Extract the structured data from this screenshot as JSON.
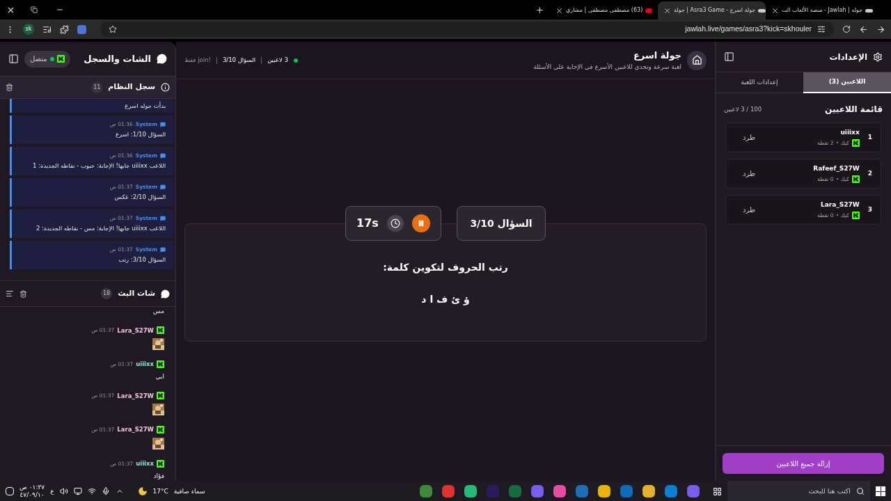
{
  "browser": {
    "tabs": [
      {
        "title": "جولة | Jawlah - منصة الألعاب الت",
        "selected": false
      },
      {
        "title": "جولة اسرع - Asra3 Game | جولة",
        "selected": true
      },
      {
        "title": "(63) مصطفى مصطفى | مشاري",
        "selected": false
      }
    ],
    "url": "jawlah.live/games/asra3?kick=skhouler",
    "profile": "sk"
  },
  "chat_panel": {
    "title": "الشات والسجل",
    "status": "متصل",
    "connected": true,
    "log": {
      "title": "سجل النظام",
      "count": "11",
      "entries": [
        {
          "text": "بدأت جوله اسرع"
        },
        {
          "sender": "System",
          "time": "01:36 ص",
          "text": "السؤال 1/10: اسرع"
        },
        {
          "sender": "System",
          "time": "01:36 ص",
          "text": "اللاعب uiiixx جابها! الإجابة: حبوب - نقاطه الجديدة: 1"
        },
        {
          "sender": "System",
          "time": "01:37 ص",
          "text": "السؤال 2/10: عكس"
        },
        {
          "sender": "System",
          "time": "01:37 ص",
          "text": "اللاعب uiiixx جابها! الإجابة: مس - نقاطه الجديدة: 2"
        },
        {
          "sender": "System",
          "time": "01:37 ص",
          "text": "السؤال 3/10: رتب"
        }
      ]
    },
    "chat": {
      "title": "شات البث",
      "count": "18",
      "messages": [
        {
          "kind": "text",
          "text": "مس"
        },
        {
          "user": "Lara_S27W",
          "color": "#f2c6e6",
          "time": "01:37 ص"
        },
        {
          "kind": "text",
          "user": "uiiixx",
          "color": "#8ee6d6",
          "time": "01:37 ص",
          "text": "ابي"
        },
        {
          "user": "Lara_S27W",
          "color": "#f2c6e6",
          "time": "01:37 ص"
        },
        {
          "user": "Lara_S27W",
          "color": "#f2c6e6",
          "time": "01:37 ص"
        },
        {
          "kind": "text",
          "user": "uiiixx",
          "color": "#8ee6d6",
          "time": "01:37 ص",
          "text": "فؤاد"
        }
      ]
    }
  },
  "header": {
    "title": "جولة اسرع",
    "subtitle": "لعبة سرعة وتحدي للاعبين الأسرع في الإجابة على الأسئلة",
    "players": "3 لاعبين",
    "question": "السؤال 3/10",
    "join": "!join فقط"
  },
  "game": {
    "timer": "17s",
    "paused": false,
    "question_label": "السؤال 3/10",
    "prompt": "رتب الحروف لتكوين كلمة:",
    "letters": "ؤ ئ ف ا د"
  },
  "settings": {
    "title": "الإعدادات",
    "tabs": [
      {
        "label": "اللاعبين (3)",
        "selected": true
      },
      {
        "label": "إعدادات اللعبة",
        "selected": false
      }
    ],
    "list_title": "قائمة اللاعبين",
    "capacity": "100 / 3 لاعبين",
    "players": [
      {
        "rank": "1",
        "name": "uiiixx",
        "platform": "كيك",
        "points": "2 نقطة",
        "kick": "طرد"
      },
      {
        "rank": "2",
        "name": "Rafeef_S27W",
        "platform": "كيك",
        "points": "0 نقطة",
        "kick": "طرد"
      },
      {
        "rank": "3",
        "name": "Lara_S27W",
        "platform": "كيك",
        "points": "0 نقطة",
        "kick": "طرد"
      }
    ],
    "remove_all": "إزالة جميع اللاعبين"
  },
  "taskbar": {
    "search_placeholder": "اكتب هنا للبحث",
    "weather": "سماء صافية",
    "temperature": "17°C",
    "language": "ع",
    "time": "٠١:٣٧ ص",
    "date": "٤٧/٠٩/١٠"
  }
}
